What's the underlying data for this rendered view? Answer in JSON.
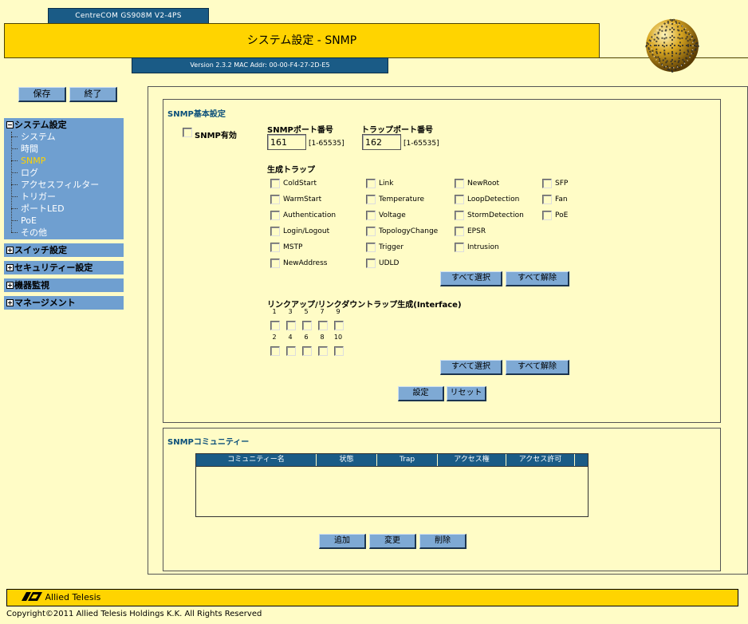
{
  "header": {
    "model": "CentreCOM GS908M V2-4PS",
    "title": "システム設定 - SNMP",
    "version": "Version 2.3.2 MAC Addr: 00-00-F4-27-2D-E5"
  },
  "sidebar": {
    "save_label": "保存",
    "exit_label": "終了",
    "system_menu": {
      "label": "システム設定",
      "items": [
        "システム",
        "時間",
        "SNMP",
        "ログ",
        "アクセスフィルター",
        "トリガー",
        "ポートLED",
        "PoE",
        "その他"
      ],
      "active": "SNMP"
    },
    "collapsed_menus": [
      "スイッチ設定",
      "セキュリティー設定",
      "機器監視",
      "マネージメント"
    ]
  },
  "snmp_basic": {
    "title": "SNMP基本設定",
    "enable_label": "SNMP有効",
    "port_label": "SNMPポート番号",
    "port_value": "161",
    "port_range": "[1-65535]",
    "trap_port_label": "トラップポート番号",
    "trap_port_value": "162",
    "trap_port_range": "[1-65535]",
    "traps_label": "生成トラップ",
    "trap_columns": [
      [
        "ColdStart",
        "WarmStart",
        "Authentication",
        "Login/Logout",
        "MSTP",
        "NewAddress"
      ],
      [
        "Link",
        "Temperature",
        "Voltage",
        "TopologyChange",
        "Trigger",
        "UDLD"
      ],
      [
        "NewRoot",
        "LoopDetection",
        "StormDetection",
        "EPSR",
        "Intrusion"
      ],
      [
        "SFP",
        "Fan",
        "PoE"
      ]
    ],
    "select_all_label": "すべて選択",
    "clear_all_label": "すべて解除",
    "link_trap_label": "リンクアップ/リンクダウントラップ生成(Interface)",
    "ports_odd": [
      "1",
      "3",
      "5",
      "7",
      "9"
    ],
    "ports_even": [
      "2",
      "4",
      "6",
      "8",
      "10"
    ],
    "set_label": "設定",
    "reset_label": "リセット"
  },
  "snmp_community": {
    "title": "SNMPコミュニティー",
    "columns": [
      "コミュニティー名",
      "状態",
      "Trap",
      "アクセス権",
      "アクセス許可"
    ],
    "rows": [],
    "add_label": "追加",
    "modify_label": "変更",
    "delete_label": "削除"
  },
  "footer": {
    "brand": "Allied Telesis",
    "copyright": "Copyright©2011 Allied Telesis Holdings K.K. All Rights Reserved"
  }
}
